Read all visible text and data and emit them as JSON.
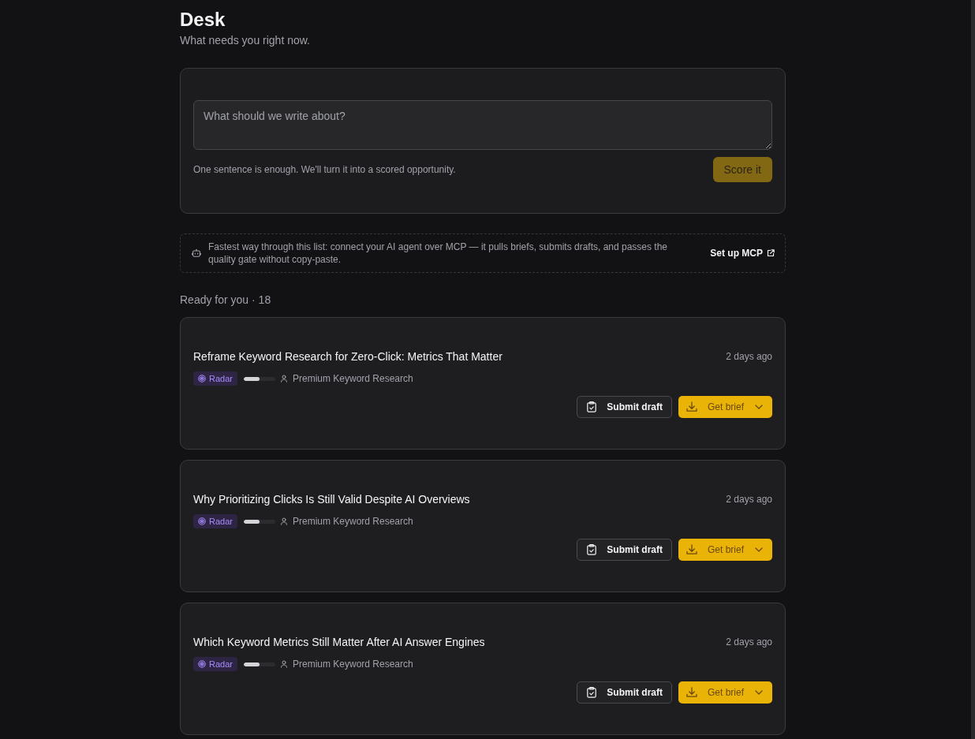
{
  "header": {
    "title": "Desk",
    "subtitle": "What needs you right now."
  },
  "composer": {
    "placeholder": "What should we write about?",
    "hint": "One sentence is enough. We'll turn it into a scored opportunity.",
    "submit": {
      "label": "Score it",
      "disabled": true
    }
  },
  "mcp_banner": {
    "text": "Fastest way through this list: connect your AI agent over MCP — it pulls briefs, submits drafts, and passes the quality gate without copy-paste.",
    "link": "Set up MCP"
  },
  "queue": {
    "heading": "Ready for you · 18",
    "items": [
      {
        "title": "Reframe Keyword Research for Zero-Click: Metrics That Matter",
        "age": "2 days ago",
        "tag": "Radar",
        "level": 0.5,
        "owner": "Premium Keyword Research",
        "secondary_action": "Submit draft",
        "primary_action": "Get brief"
      },
      {
        "title": "Why Prioritizing Clicks Is Still Valid Despite AI Overviews",
        "age": "2 days ago",
        "tag": "Radar",
        "level": 0.5,
        "owner": "Premium Keyword Research",
        "secondary_action": "Submit draft",
        "primary_action": "Get brief"
      },
      {
        "title": "Which Keyword Metrics Still Matter After AI Answer Engines",
        "age": "2 days ago",
        "tag": "Radar",
        "level": 0.5,
        "owner": "Premium Keyword Research",
        "secondary_action": "Submit draft",
        "primary_action": "Get brief"
      }
    ]
  }
}
